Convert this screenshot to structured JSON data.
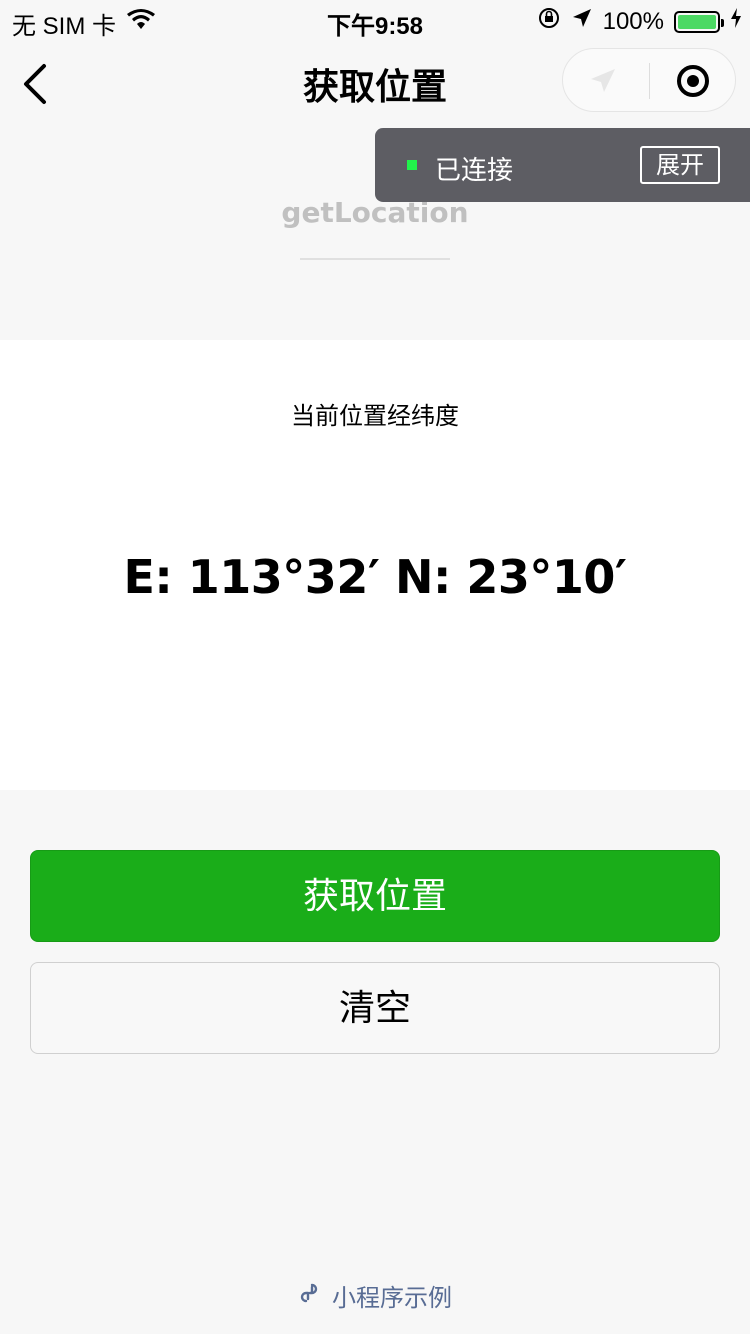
{
  "status_bar": {
    "carrier": "无 SIM 卡",
    "time": "下午9:58",
    "battery_percent": "100%",
    "battery_level": 1.0,
    "icons": [
      "wifi-icon",
      "orientation-lock-icon",
      "location-arrow-icon",
      "battery-icon",
      "charging-bolt-icon"
    ]
  },
  "nav": {
    "title": "获取位置",
    "icons": [
      "back-arrow-icon",
      "navigation-icon",
      "record-icon"
    ]
  },
  "debug_panel": {
    "status": "已连接",
    "expand_label": "展开",
    "status_color": "#21f34b"
  },
  "header": {
    "api_name": "getLocation"
  },
  "card": {
    "label": "当前位置经纬度",
    "coordinates": "E: 113°32′  N: 23°10′"
  },
  "buttons": {
    "get_location": "获取位置",
    "clear": "清空"
  },
  "footer": {
    "label": "小程序示例",
    "icon": "link-icon"
  },
  "colors": {
    "primary_green": "#1aad19",
    "background": "#f7f7f7",
    "footer_link": "#586c94"
  }
}
